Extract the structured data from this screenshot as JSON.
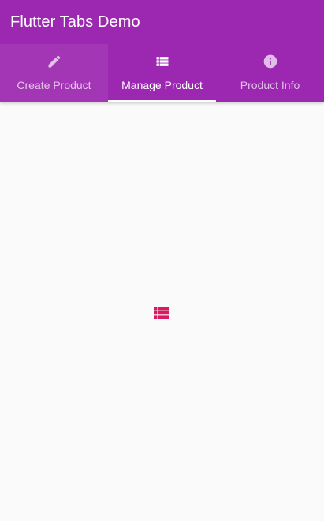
{
  "app_bar": {
    "title": "Flutter Tabs Demo",
    "background_color": "#9c27b0"
  },
  "tabs": [
    {
      "label": "Create Product",
      "icon": "edit-pencil-icon",
      "selected": false,
      "pressed": true
    },
    {
      "label": "Manage Product",
      "icon": "list-icon",
      "selected": true,
      "pressed": false
    },
    {
      "label": "Product Info",
      "icon": "info-icon",
      "selected": false,
      "pressed": false
    }
  ],
  "tab_indicator_color": "#ffffff",
  "content": {
    "icon": "list-icon",
    "icon_color": "#d81b60",
    "background_color": "#fafafa"
  }
}
